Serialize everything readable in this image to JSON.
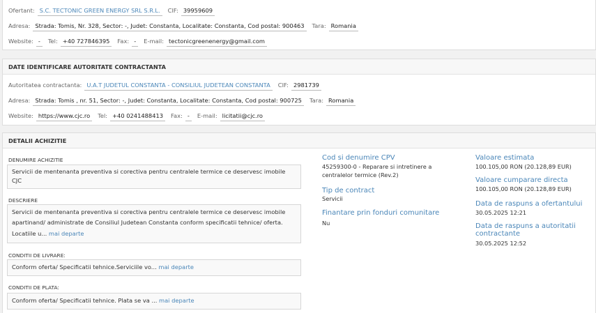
{
  "ofertant": {
    "label": "Ofertant:",
    "name": "S.C. TECTONIC GREEN ENERGY SRL S.R.L.",
    "cif_label": "CIF:",
    "cif": "39959609",
    "address_label": "Adresa:",
    "address": "Strada: Tomis, Nr. 328, Sector: -, Judet: Constanta, Localitate: Constanta, Cod postal: 900463",
    "country_label": "Tara:",
    "country": "Romania",
    "website_label": "Website:",
    "website": "-",
    "tel_label": "Tel:",
    "tel": "+40 727846395",
    "fax_label": "Fax:",
    "fax": "-",
    "email_label": "E-mail:",
    "email": "tectonicgreenenergy@gmail.com"
  },
  "autoritate": {
    "title": "DATE IDENTIFICARE AUTORITATE CONTRACTANTA",
    "label": "Autoritatea contractanta:",
    "name": "U.A.T JUDETUL CONSTANTA - CONSILIUL JUDETEAN CONSTANTA",
    "cif_label": "CIF:",
    "cif": "2981739",
    "address_label": "Adresa:",
    "address": "Strada: Tomis , nr. 51, Sector: -, Judet: Constanta, Localitate: Constanta, Cod postal: 900725",
    "country_label": "Tara:",
    "country": "Romania",
    "website_label": "Website:",
    "website": "https://www.cjc.ro",
    "tel_label": "Tel:",
    "tel": "+40 0241488413",
    "fax_label": "Fax:",
    "fax": "-",
    "email_label": "E-mail:",
    "email": "licitatii@cjc.ro"
  },
  "detalii": {
    "title": "DETALII ACHIZITIE",
    "denumire_label": "DENUMIRE ACHIZITIE",
    "denumire": "Servicii de mentenanta preventiva si corectiva pentru centralele termice ce deservesc imobile CJC",
    "descriere_label": "DESCRIERE",
    "descriere": "Servicii de mentenanta preventiva si corectiva pentru centralele termice ce deservesc imobile apartinand/ administrate de Consiliul Judetean Constanta conform specificatii tehnice/ oferta. Locatiile u...",
    "livrare_label": "CONDITII DE LIVRARE:",
    "livrare": "Conform oferta/ Specificatii tehnice.Serviciile vo...",
    "plata_label": "CONDITII DE PLATA:",
    "plata": "Conform oferta/ Specificatii tehnice. Plata se va ...",
    "more_link": "mai departe",
    "cpv_label": "Cod si denumire CPV",
    "cpv": "45259300-0 - Reparare si intretinere a centralelor termice (Rev.2)",
    "tip_label": "Tip de contract",
    "tip": "Servicii",
    "fonduri_label": "Finantare prin fonduri comunitare",
    "fonduri": "Nu",
    "valoare_label": "Valoare estimata",
    "valoare": "100.105,00  RON (20.128,89  EUR)",
    "cumparare_label": "Valoare cumparare directa",
    "cumparare": "100.105,00  RON (20.128,89  EUR)",
    "raspuns_ofertant_label": "Data de raspuns a ofertantului",
    "raspuns_ofertant": "30.05.2025 12:21",
    "raspuns_autoritate_label": "Data de raspuns a autoritatii contractante",
    "raspuns_autoritate": "30.05.2025 12:52"
  }
}
